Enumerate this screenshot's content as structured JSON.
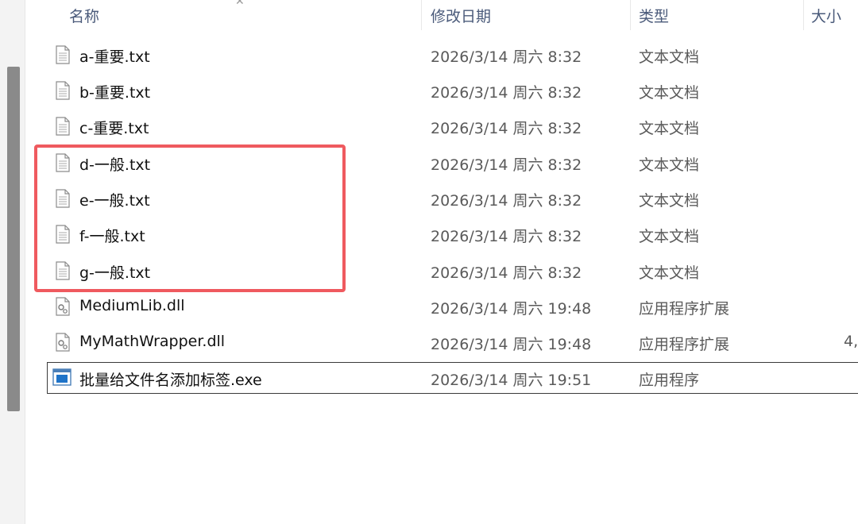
{
  "header": {
    "name_label": "名称",
    "date_label": "修改日期",
    "type_label": "类型",
    "size_label": "大小"
  },
  "files": [
    {
      "name": "a-重要.txt",
      "date": "2026/3/14 周六 8:32",
      "type": "文本文档",
      "size": "",
      "icon": "text-file-icon"
    },
    {
      "name": "b-重要.txt",
      "date": "2026/3/14 周六 8:32",
      "type": "文本文档",
      "size": "",
      "icon": "text-file-icon"
    },
    {
      "name": "c-重要.txt",
      "date": "2026/3/14 周六 8:32",
      "type": "文本文档",
      "size": "",
      "icon": "text-file-icon"
    },
    {
      "name": "d-一般.txt",
      "date": "2026/3/14 周六 8:32",
      "type": "文本文档",
      "size": "",
      "icon": "text-file-icon"
    },
    {
      "name": "e-一般.txt",
      "date": "2026/3/14 周六 8:32",
      "type": "文本文档",
      "size": "",
      "icon": "text-file-icon"
    },
    {
      "name": "f-一般.txt",
      "date": "2026/3/14 周六 8:32",
      "type": "文本文档",
      "size": "",
      "icon": "text-file-icon"
    },
    {
      "name": "g-一般.txt",
      "date": "2026/3/14 周六 8:32",
      "type": "文本文档",
      "size": "",
      "icon": "text-file-icon"
    },
    {
      "name": "MediumLib.dll",
      "date": "2026/3/14 周六 19:48",
      "type": "应用程序扩展",
      "size": "",
      "icon": "dll-file-icon"
    },
    {
      "name": "MyMathWrapper.dll",
      "date": "2026/3/14 周六 19:48",
      "type": "应用程序扩展",
      "size": "4,",
      "icon": "dll-file-icon"
    },
    {
      "name": "批量给文件名添加标签.exe",
      "date": "2026/3/14 周六 19:51",
      "type": "应用程序",
      "size": "",
      "icon": "exe-file-icon"
    }
  ],
  "colors": {
    "highlight_border": "#ef5a5f",
    "header_text": "#4a5a7a",
    "exe_icon_blue": "#1e73c8"
  }
}
